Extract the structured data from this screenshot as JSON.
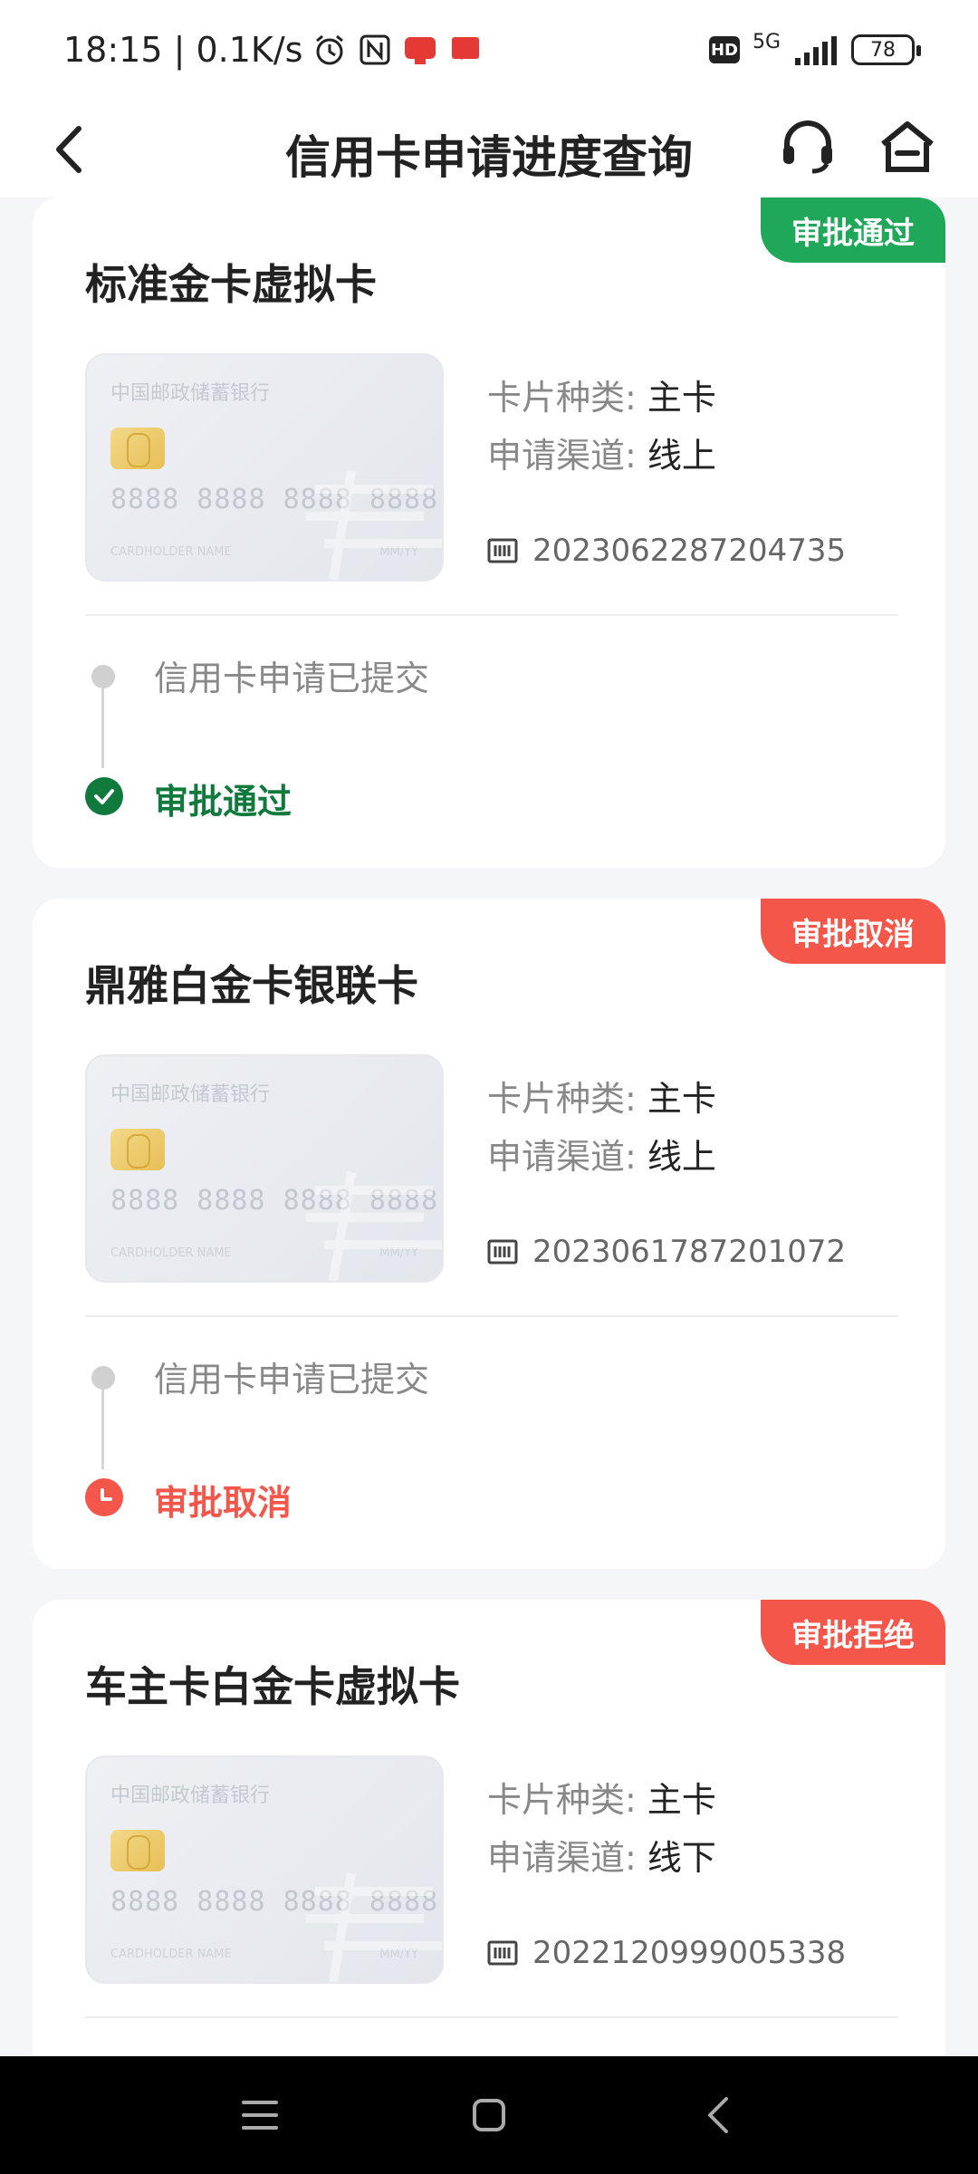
{
  "status_bar": {
    "time_text": "18:15 | 0.1K/s",
    "hd": "HD",
    "network": "5G",
    "battery": "78",
    "icons": [
      "alarm-icon",
      "nfc-icon",
      "app-notification-icon",
      "message-notification-icon"
    ]
  },
  "header": {
    "title": "信用卡申请进度查询",
    "icons": [
      "back-icon",
      "customer-service-icon",
      "home-icon"
    ]
  },
  "card_image": {
    "bank_name": "中国邮政储蓄银行",
    "number": "8888 8888 8888 8888",
    "holder": "CARDHOLDER NAME",
    "expiry": "MM/YY"
  },
  "labels": {
    "card_type": "卡片种类:",
    "channel": "申请渠道:"
  },
  "applications": [
    {
      "status": "审批通过",
      "status_color": "#1fa85a",
      "title": "标准金卡虚拟卡",
      "card_type": "主卡",
      "channel": "线上",
      "application_no": "2023062287204735",
      "step1": "信用卡申请已提交",
      "final_step": "审批通过",
      "final_color": "#0f7a3c"
    },
    {
      "status": "审批取消",
      "status_color": "#f5564a",
      "title": "鼎雅白金卡银联卡",
      "card_type": "主卡",
      "channel": "线上",
      "application_no": "2023061787201072",
      "step1": "信用卡申请已提交",
      "final_step": "审批取消",
      "final_color": "#f5564a"
    },
    {
      "status": "审批拒绝",
      "status_color": "#f5564a",
      "title": "车主卡白金卡虚拟卡",
      "card_type": "主卡",
      "channel": "线下",
      "application_no": "2022120999005338"
    }
  ],
  "nav_bar": {
    "icons": [
      "menu-icon",
      "home-square-icon",
      "back-triangle-icon"
    ]
  }
}
